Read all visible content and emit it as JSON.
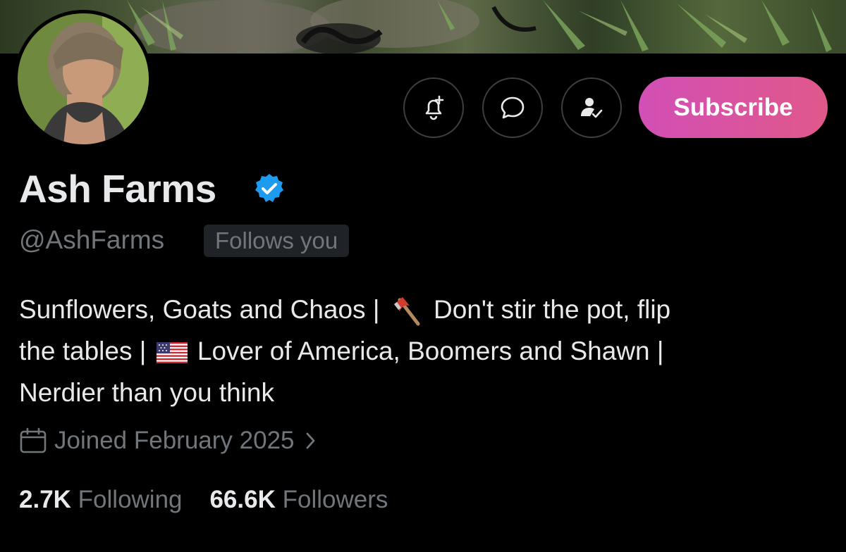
{
  "profile": {
    "name": "Ash Farms",
    "handle": "@AshFarms",
    "follows_you": "Follows you",
    "bio_line1_a": "Sunflowers, Goats and Chaos |",
    "bio_line1_b": "Don't stir the pot, flip",
    "bio_line2_a": "the tables |",
    "bio_line2_b": "Lover of America, Boomers and Shawn |",
    "bio_line3": "Nerdier than you think",
    "joined": "Joined February 2025",
    "following_count": "2.7K",
    "following_label": "Following",
    "followers_count": "66.6K",
    "followers_label": "Followers"
  },
  "actions": {
    "subscribe_label": "Subscribe",
    "icons": [
      "notification-bell-plus-icon",
      "message-bubble-icon",
      "person-check-icon"
    ]
  },
  "colors": {
    "background": "#000000",
    "text_primary": "#e7e9ea",
    "text_secondary": "#71767b",
    "verified_blue": "#1d9bf0",
    "subscribe_gradient_start": "#d24fb6",
    "subscribe_gradient_end": "#e0588a"
  }
}
